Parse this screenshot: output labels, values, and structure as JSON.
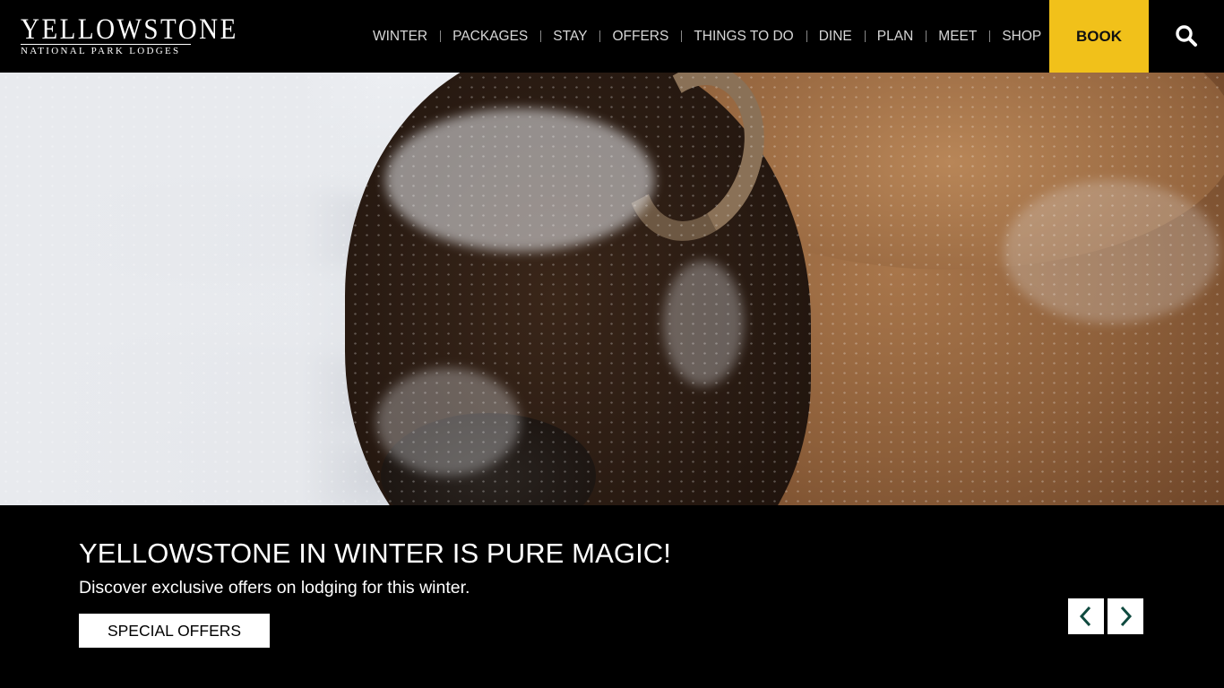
{
  "header": {
    "logo_title": "YELLOWSTONE",
    "logo_subtitle": "NATIONAL PARK LODGES",
    "nav": [
      "WINTER",
      "PACKAGES",
      "STAY",
      "OFFERS",
      "THINGS TO DO",
      "DINE",
      "PLAN",
      "MEET",
      "SHOP"
    ],
    "book_label": "BOOK",
    "search_icon": "search-icon"
  },
  "hero": {
    "image_subject": "bison-in-snow",
    "headline": "YELLOWSTONE IN WINTER IS PURE MAGIC!",
    "subtext": "Discover exclusive offers on lodging for this winter.",
    "cta_label": "SPECIAL OFFERS",
    "prev_icon": "chevron-left-icon",
    "next_icon": "chevron-right-icon"
  },
  "colors": {
    "background": "#000000",
    "book_accent": "#f1c11a",
    "arrow_icon": "#0f4a3f"
  }
}
